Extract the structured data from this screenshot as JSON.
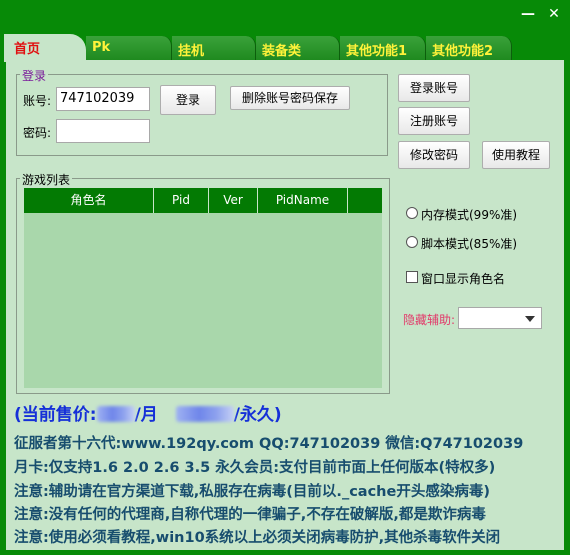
{
  "window": {
    "minimize_glyph": "—",
    "close_glyph": "✕"
  },
  "tabs": [
    {
      "label": "首页",
      "active": true
    },
    {
      "label": "Pk"
    },
    {
      "label": "挂机"
    },
    {
      "label": "装备类"
    },
    {
      "label": "其他功能1"
    },
    {
      "label": "其他功能2"
    }
  ],
  "login": {
    "group_title": "登录",
    "account_label": "账号:",
    "account_value": "747102039",
    "password_label": "密码:",
    "password_value": "",
    "login_button": "登录",
    "delete_button": "删除账号密码保存"
  },
  "right_buttons": {
    "login_account": "登录账号",
    "register_account": "注册账号",
    "change_password": "修改密码",
    "tutorial": "使用教程"
  },
  "game_list": {
    "group_title": "游戏列表",
    "columns": [
      "角色名",
      "Pid",
      "Ver",
      "PidName",
      ""
    ]
  },
  "options": {
    "memory_mode": "内存模式(99%准)",
    "script_mode": "脚本模式(85%准)",
    "show_role_name": "窗口显示角色名",
    "hidden_assist_label": "隐藏辅助:",
    "hidden_assist_value": ""
  },
  "price": {
    "prefix": "(当前售价:",
    "month_suffix": "/月",
    "forever_suffix": "/永久)"
  },
  "notices": [
    "征服者第十六代:www.192qy.com  QQ:747102039 微信:Q747102039",
    "月卡:仅支持1.6 2.0 2.6 3.5 永久会员:支付目前市面上任何版本(特权多)",
    "注意:辅助请在官方渠道下载,私服存在病毒(目前以._cache开头感染病毒)",
    "注意:没有任何的代理商,自称代理的一律骗子,不存在破解版,都是欺诈病毒",
    "注意:使用必须看教程,win10系统以上必须关闭病毒防护,其他杀毒软件关闭"
  ],
  "colors": {
    "frame": "#078a07",
    "panel": "#c7e5c9",
    "tab_text": "#fff23a",
    "active_tab_text": "#e01010",
    "price_text": "#1530d8",
    "notice_text": "#174d6e",
    "hidden_label": "#e23a6a"
  }
}
